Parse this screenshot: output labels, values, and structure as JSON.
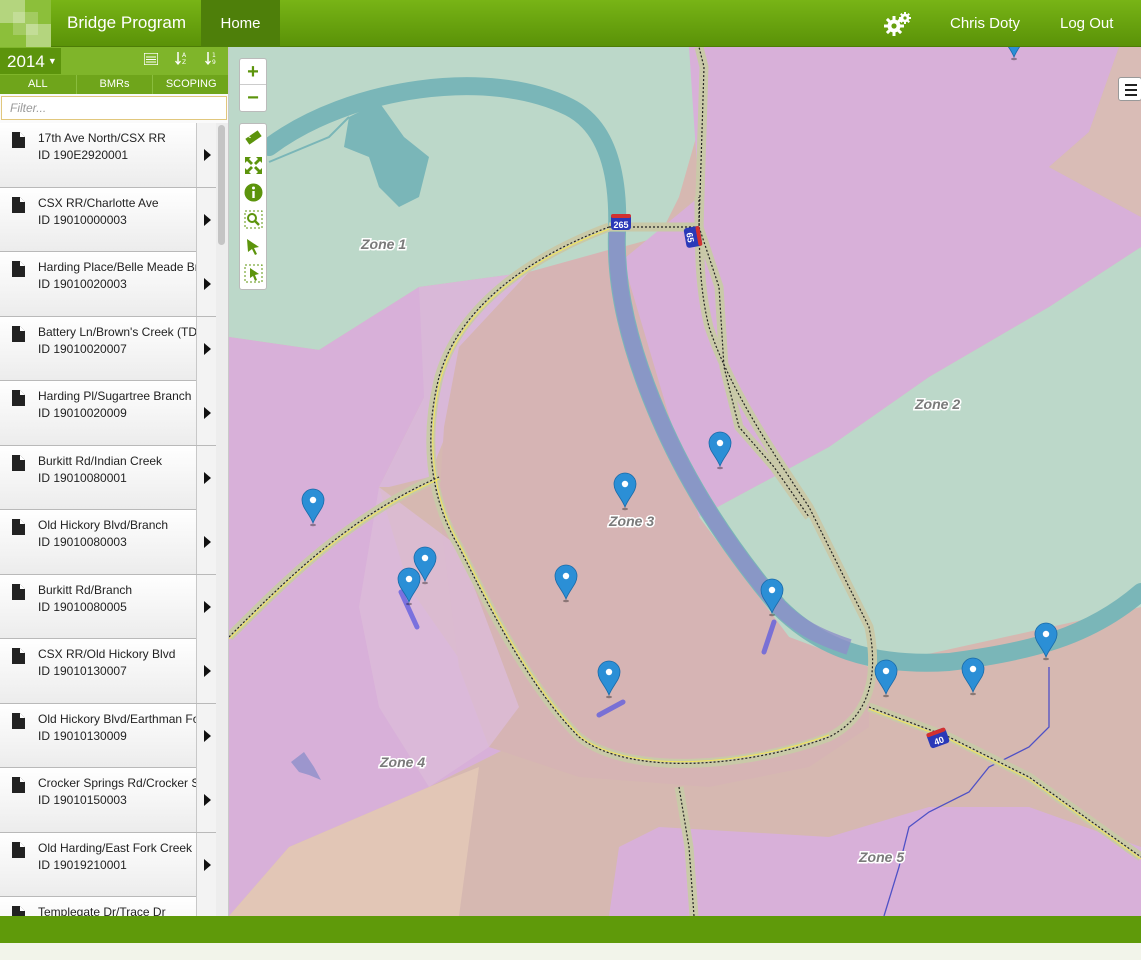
{
  "header": {
    "title": "Bridge Program",
    "nav_home": "Home",
    "user": "Chris Doty",
    "logout": "Log Out",
    "settings_icon": "gears-icon"
  },
  "sidebar": {
    "year": "2014",
    "tabs": [
      "ALL",
      "BMRs",
      "SCOPING"
    ],
    "filter_placeholder": "Filter...",
    "items": [
      {
        "name": "17th Ave North/CSX RR",
        "id": "ID 190E2920001"
      },
      {
        "name": "CSX RR/Charlotte Ave",
        "id": "ID 19010000003"
      },
      {
        "name": "Harding Place/Belle Meade Bra",
        "id": "ID 19010020003"
      },
      {
        "name": "Battery Ln/Brown's Creek (TDC",
        "id": "ID 19010020007"
      },
      {
        "name": "Harding Pl/Sugartree Branch",
        "id": "ID 19010020009"
      },
      {
        "name": "Burkitt Rd/Indian Creek",
        "id": "ID 19010080001"
      },
      {
        "name": "Old Hickory Blvd/Branch",
        "id": "ID 19010080003"
      },
      {
        "name": "Burkitt Rd/Branch",
        "id": "ID 19010080005"
      },
      {
        "name": "CSX RR/Old Hickory Blvd",
        "id": "ID 19010130007"
      },
      {
        "name": "Old Hickory Blvd/Earthman For",
        "id": "ID 19010130009"
      },
      {
        "name": "Crocker Springs Rd/Crocker Spr",
        "id": "ID 19010150003"
      },
      {
        "name": "Old Harding/East Fork Creek",
        "id": "ID 19019210001"
      },
      {
        "name": "Templegate Dr/Trace Dr",
        "id": ""
      }
    ]
  },
  "map": {
    "zones": [
      "Zone 1",
      "Zone 2",
      "Zone 3",
      "Zone 4",
      "Zone 5"
    ],
    "highway_shields": [
      "265",
      "65",
      "40"
    ],
    "zoom_in": "+",
    "zoom_out": "−",
    "colors": {
      "zone_green": "#bcd8c9",
      "zone_pink": "#d8b0d9",
      "zone_tan": "#d6b8b1",
      "river": "#7ab6b8",
      "marker": "#2b8fd6"
    }
  },
  "colors": {
    "brand_green": "#6aa513",
    "nav_dark": "#4e7f0a",
    "footer": "#5f9a0a"
  }
}
